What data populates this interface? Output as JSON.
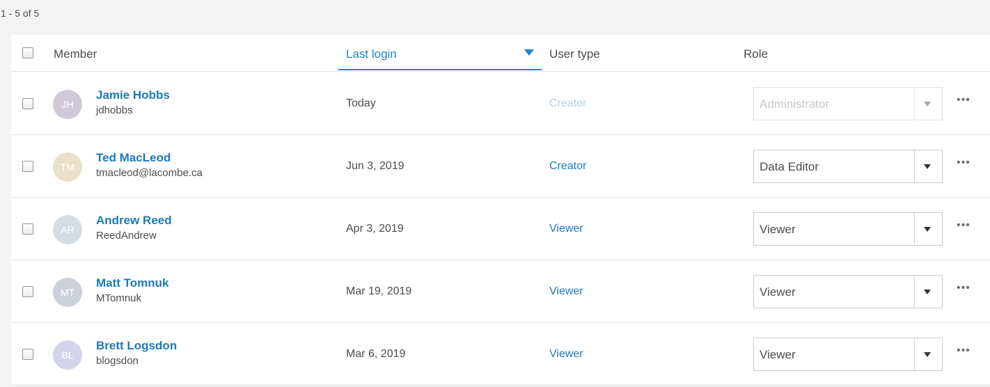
{
  "pagination": {
    "summary": "1 - 5 of 5"
  },
  "table": {
    "columns": {
      "member": "Member",
      "last_login": "Last login",
      "user_type": "User type",
      "role": "Role"
    },
    "sort": {
      "column": "Last login",
      "direction": "descending"
    },
    "rows": [
      {
        "initials": "JH",
        "avatar_color": "#d1c9d8",
        "name": "Jamie Hobbs",
        "username": "jdhobbs",
        "last_login": "Today",
        "user_type": "Creator",
        "role": "Administrator",
        "disabled": true
      },
      {
        "initials": "TM",
        "avatar_color": "#e8e0c8",
        "name": "Ted MacLeod",
        "username": "tmacleod@lacombe.ca",
        "last_login": "Jun 3, 2019",
        "user_type": "Creator",
        "role": "Data Editor",
        "disabled": false
      },
      {
        "initials": "AR",
        "avatar_color": "#d5dde3",
        "name": "Andrew Reed",
        "username": "ReedAndrew",
        "last_login": "Apr 3, 2019",
        "user_type": "Viewer",
        "role": "Viewer",
        "disabled": false
      },
      {
        "initials": "MT",
        "avatar_color": "#ccd0db",
        "name": "Matt Tomnuk",
        "username": "MTomnuk",
        "last_login": "Mar 19, 2019",
        "user_type": "Viewer",
        "role": "Viewer",
        "disabled": false
      },
      {
        "initials": "BL",
        "avatar_color": "#d3d4ea",
        "name": "Brett Logsdon",
        "username": "blogsdon",
        "last_login": "Mar 6, 2019",
        "user_type": "Viewer",
        "role": "Viewer",
        "disabled": false
      }
    ]
  },
  "icons": {
    "sort": "triangle-down-icon",
    "dropdown": "chevron-down-icon",
    "more": "more-horizontal-icon"
  },
  "colors": {
    "accent": "#1d86c8",
    "link": "#1d79b7",
    "link_disabled": "#b3cfe4"
  }
}
